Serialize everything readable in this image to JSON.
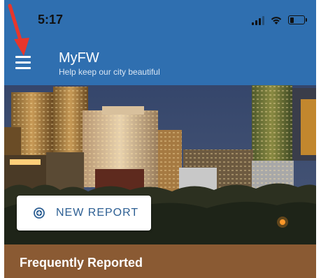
{
  "status_bar": {
    "time": "5:17",
    "icons": [
      "cellular-signal-icon",
      "wifi-icon",
      "battery-icon"
    ],
    "battery_level_percent": 30
  },
  "app_bar": {
    "title": "MyFW",
    "subtitle": "Help keep our city beautiful",
    "menu_icon": "hamburger-menu-icon"
  },
  "hero": {
    "image": "city-skyline-photo"
  },
  "actions": {
    "new_report_label": "NEW REPORT",
    "new_report_icon": "add-circle-icon"
  },
  "sections": {
    "frequently_reported_title": "Frequently Reported"
  },
  "colors": {
    "primary": "#2f6fb0",
    "button_text": "#2d5f93",
    "section_bar": "#8a5a33",
    "annotation_arrow": "#e8362b"
  }
}
